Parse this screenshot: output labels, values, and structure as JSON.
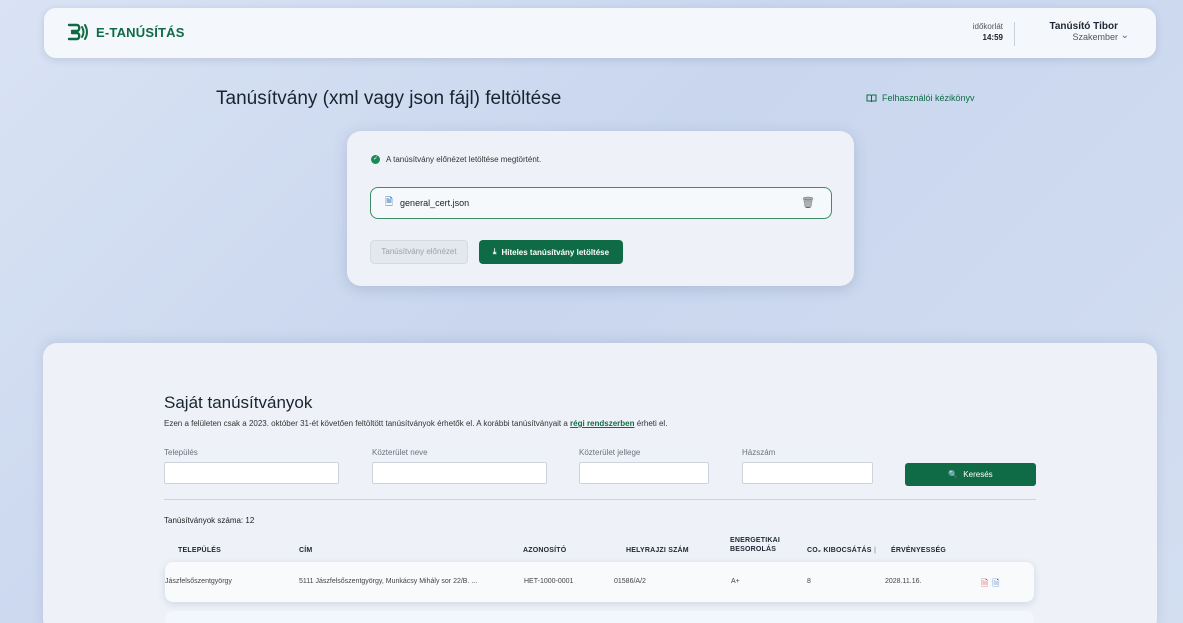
{
  "header": {
    "app_name": "E-TANÚSÍTÁS",
    "timeout_label": "időkorlát",
    "timeout_value": "14:59",
    "user_name": "Tanúsító Tibor",
    "user_role": "Szakember"
  },
  "upload": {
    "title": "Tanúsítvány (xml vagy json fájl) feltöltése",
    "manual_link": "Felhasználói kézikönyv",
    "success_message": "A tanúsítvány előnézet letöltése megtörtént.",
    "file_name": "general_cert.json",
    "preview_button": "Tanúsítvány előnézet",
    "download_button": "Hiteles tanúsítvány letöltése"
  },
  "own": {
    "title": "Saját tanúsítványok",
    "desc_prefix": "Ezen a felületen csak a 2023. október 31-ét követően feltöltött tanúsítványok érhetők el. A korábbi tanúsítványait a",
    "desc_link": "régi rendszerben",
    "desc_suffix": "érheti el.",
    "filters": {
      "settlement": "Település",
      "street_name": "Közterület neve",
      "street_type": "Közterület jellege",
      "house_number": "Házszám"
    },
    "search_button": "Keresés",
    "count_text": "Tanúsítványok száma: 12",
    "columns": {
      "settlement": "TELEPÜLÉS",
      "address": "CÍM",
      "id": "AZONOSÍTÓ",
      "plot": "HELYRAJZI SZÁM",
      "energy_line1": "ENERGETIKAI",
      "energy_line2": "BESOROLÁS",
      "co2": "CO₂ KIBOCSÁTÁS",
      "validity": "ÉRVÉNYESSÉG"
    },
    "rows": [
      {
        "settlement": "Jászfelsőszentgyörgy",
        "address": "5111 Jászfelsőszentgyörgy, Munkácsy Mihály sor 22/B. ...",
        "id": "HET-1000-0001",
        "plot": "01586/A/2",
        "energy": "A+",
        "co2": "8",
        "validity": "2028.11.16."
      }
    ]
  },
  "colors": {
    "brand_green": "#0f6b45",
    "background": "#cfdaef"
  }
}
